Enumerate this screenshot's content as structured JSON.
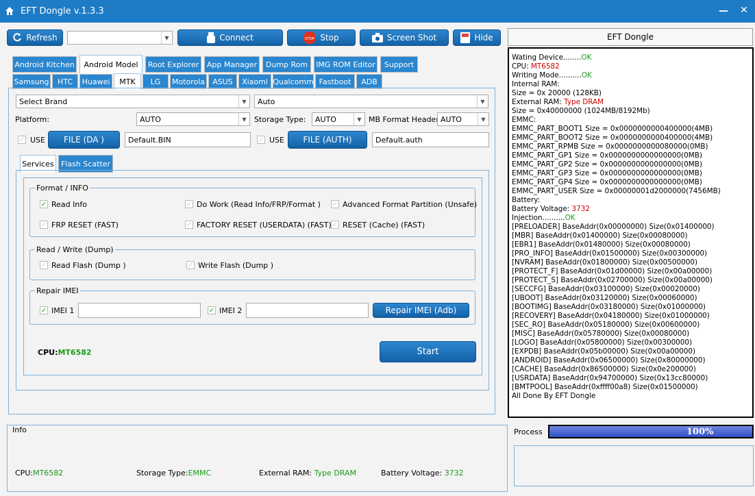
{
  "window": {
    "title": "EFT Dongle  v.1.3.3"
  },
  "toolbar": {
    "refresh": "Refresh",
    "connect": "Connect",
    "stop": "Stop",
    "screenshot": "Screen Shot",
    "hide": "Hide",
    "brand_right": "EFT Dongle"
  },
  "tabs_main": [
    "Android Kitchen",
    "Android Model",
    "Root Explorer",
    "App Manager",
    "Dump Rom",
    "IMG ROM Editor",
    "Support"
  ],
  "tabs_brand": [
    "Samsung",
    "HTC",
    "Huawei",
    "MTK",
    "LG",
    "Motorola",
    "ASUS",
    "Xiaomi",
    "Qualcomm",
    "Fastboot",
    "ADB"
  ],
  "selectors": {
    "brand": "Select Brand",
    "auto": "Auto",
    "platform_label": "Platform:",
    "platform_value": "AUTO",
    "storage_label": "Storage Type:",
    "storage_value": "AUTO",
    "mb_label": "MB Format Header",
    "mb_value": "AUTO"
  },
  "files": {
    "use1": "USE",
    "da_button": "FILE (DA )",
    "da_value": "Default.BIN",
    "use2": "USE",
    "auth_button": "FILE (AUTH)",
    "auth_value": "Default.auth"
  },
  "subtabs": [
    "Services",
    "Flash Scatter"
  ],
  "format_info": {
    "title": "Format / INFO",
    "read_info": "Read Info",
    "do_work": "Do Work (Read Info/FRP/Format )",
    "adv_format": "Advanced Format Partition (Unsafe)",
    "frp_reset": "FRP RESET (FAST)",
    "factory_reset": "FACTORY RESET (USERDATA) (FAST)",
    "reset_cache": "RESET (Cache) (FAST)"
  },
  "read_write": {
    "title": "Read / Write (Dump)",
    "read_flash": "Read Flash (Dump )",
    "write_flash": "Write Flash (Dump )"
  },
  "repair_imei": {
    "title": "Repair IMEI",
    "imei1": "IMEI 1",
    "imei2": "IMEI 2",
    "repair_button": "Repair IMEI (Adb)"
  },
  "cpu_status": {
    "label": "CPU:",
    "value": "MT6582"
  },
  "start_button": "Start",
  "log": [
    [
      [
        "Wating Device........",
        ""
      ],
      [
        "OK",
        "g"
      ]
    ],
    [
      [
        "CPU: ",
        ""
      ],
      [
        "MT6582",
        "r"
      ]
    ],
    [
      [
        "Writing Mode..........",
        ""
      ],
      [
        "OK",
        "g"
      ]
    ],
    [
      [
        "Internal RAM:",
        ""
      ]
    ],
    [
      [
        "Size = 0x 20000 (128KB)",
        ""
      ]
    ],
    [
      [
        "External RAM: ",
        ""
      ],
      [
        "Type DRAM",
        "r"
      ]
    ],
    [
      [
        "Size = 0x40000000 (1024MB/8192Mb)",
        ""
      ]
    ],
    [
      [
        "EMMC:",
        ""
      ]
    ],
    [
      [
        "EMMC_PART_BOOT1 Size = 0x0000000000400000(4MB)",
        ""
      ]
    ],
    [
      [
        "EMMC_PART_BOOT2 Size = 0x0000000000400000(4MB)",
        ""
      ]
    ],
    [
      [
        "EMMC_PART_RPMB Size = 0x0000000000080000(0MB)",
        ""
      ]
    ],
    [
      [
        "EMMC_PART_GP1 Size = 0x0000000000000000(0MB)",
        ""
      ]
    ],
    [
      [
        "EMMC_PART_GP2 Size = 0x0000000000000000(0MB)",
        ""
      ]
    ],
    [
      [
        "EMMC_PART_GP3 Size = 0x0000000000000000(0MB)",
        ""
      ]
    ],
    [
      [
        "EMMC_PART_GP4 Size = 0x0000000000000000(0MB)",
        ""
      ]
    ],
    [
      [
        "EMMC_PART_USER Size = 0x00000001d2000000(7456MB)",
        ""
      ]
    ],
    [
      [
        "Battery:",
        ""
      ]
    ],
    [
      [
        "Battery Voltage: ",
        ""
      ],
      [
        "3732",
        "r"
      ]
    ],
    [
      [
        "Injection..........",
        ""
      ],
      [
        "OK",
        "g"
      ]
    ],
    [
      [
        "[PRELOADER] BaseAddr(0x00000000) Size(0x01400000)",
        ""
      ]
    ],
    [
      [
        "[MBR] BaseAddr(0x01400000) Size(0x00080000)",
        ""
      ]
    ],
    [
      [
        "[EBR1] BaseAddr(0x01480000) Size(0x00080000)",
        ""
      ]
    ],
    [
      [
        "[PRO_INFO] BaseAddr(0x01500000) Size(0x00300000)",
        ""
      ]
    ],
    [
      [
        "[NVRAM] BaseAddr(0x01800000) Size(0x00500000)",
        ""
      ]
    ],
    [
      [
        "[PROTECT_F] BaseAddr(0x01d00000) Size(0x00a00000)",
        ""
      ]
    ],
    [
      [
        "[PROTECT_S] BaseAddr(0x02700000) Size(0x00a00000)",
        ""
      ]
    ],
    [
      [
        "[SECCFG] BaseAddr(0x03100000) Size(0x00020000)",
        ""
      ]
    ],
    [
      [
        "[UBOOT] BaseAddr(0x03120000) Size(0x00060000)",
        ""
      ]
    ],
    [
      [
        "[BOOTIMG] BaseAddr(0x03180000) Size(0x01000000)",
        ""
      ]
    ],
    [
      [
        "[RECOVERY] BaseAddr(0x04180000) Size(0x01000000)",
        ""
      ]
    ],
    [
      [
        "[SEC_RO] BaseAddr(0x05180000) Size(0x00600000)",
        ""
      ]
    ],
    [
      [
        "[MISC] BaseAddr(0x05780000) Size(0x00080000)",
        ""
      ]
    ],
    [
      [
        "[LOGO] BaseAddr(0x05800000) Size(0x00300000)",
        ""
      ]
    ],
    [
      [
        "[EXPDB] BaseAddr(0x05b00000) Size(0x00a00000)",
        ""
      ]
    ],
    [
      [
        "[ANDROID] BaseAddr(0x06500000) Size(0x80000000)",
        ""
      ]
    ],
    [
      [
        "[CACHE] BaseAddr(0x86500000) Size(0x0e200000)",
        ""
      ]
    ],
    [
      [
        "[USRDATA] BaseAddr(0x94700000) Size(0x13cc80000)",
        ""
      ]
    ],
    [
      [
        "[BMTPOOL] BaseAddr(0xffff00a8) Size(0x01500000)",
        ""
      ]
    ],
    [
      [
        "All Done By EFT Dongle",
        ""
      ]
    ]
  ],
  "info": {
    "title": "Info",
    "cpu_label": "CPU:",
    "cpu_value": "MT6582",
    "storage_label": "Storage Type:",
    "storage_value": "EMMC",
    "ext_ram_label": "External RAM: ",
    "ext_ram_value": "Type DRAM",
    "battery_label": "Battery Voltage: ",
    "battery_value": "3732"
  },
  "process": {
    "label": "Process",
    "percent_text": "100%",
    "percent": 100
  },
  "colors": {
    "accent": "#1e7cc6",
    "ok_green": "#1a9b1a",
    "value_red": "#c00000"
  }
}
